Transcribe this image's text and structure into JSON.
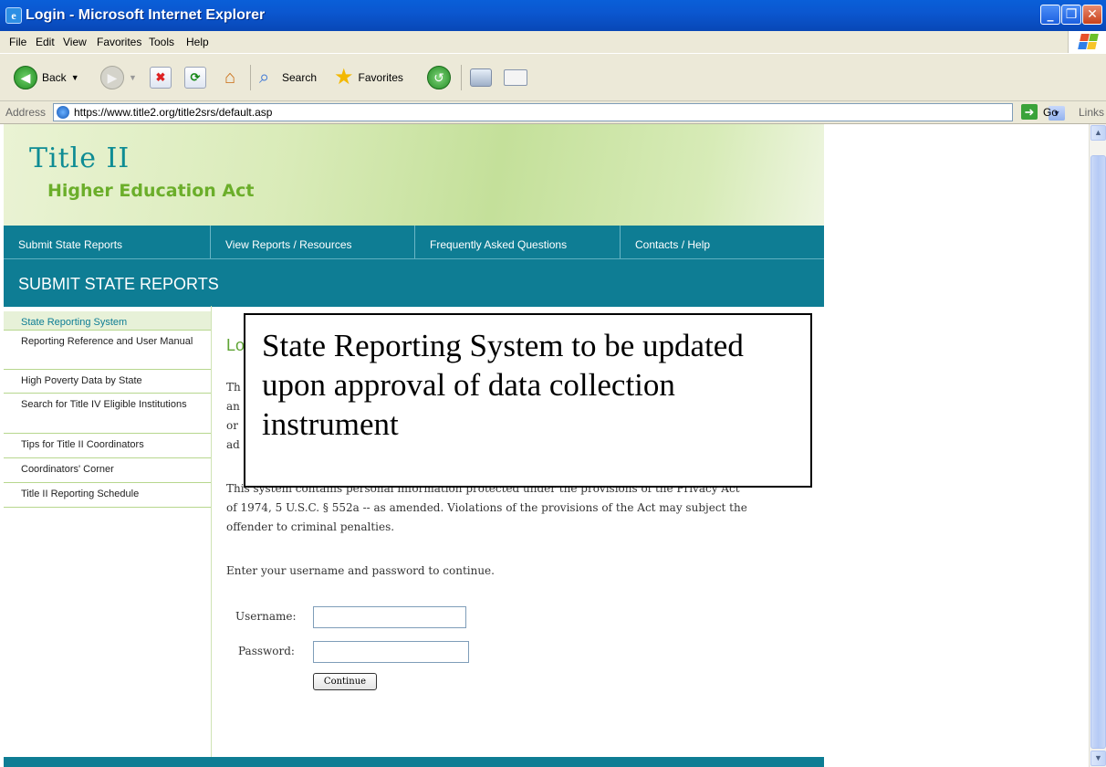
{
  "window": {
    "title": "Login - Microsoft Internet Explorer",
    "minimize": "_",
    "maximize": "❐",
    "close": "✕"
  },
  "menu": [
    "File",
    "Edit",
    "View",
    "Favorites",
    "Tools",
    "Help"
  ],
  "toolbar": {
    "back": "Back",
    "search": "Search",
    "favorites": "Favorites"
  },
  "address": {
    "label": "Address",
    "url": "https://www.title2.org/title2srs/default.asp",
    "go": "Go",
    "links": "Links"
  },
  "site": {
    "logo_title": "Title II",
    "logo_subtitle": "Higher Education Act",
    "nav": [
      "Submit State Reports",
      "View Reports / Resources",
      "Frequently Asked Questions",
      "Contacts / Help"
    ],
    "section_title": "SUBMIT STATE REPORTS",
    "sidebar": [
      "State Reporting System",
      "Reporting Reference and User Manual",
      "High Poverty Data by State",
      "Search for Title IV Eligible Institutions",
      "Tips for Title II Coordinators",
      "Coordinators' Corner",
      "Title II Reporting Schedule"
    ],
    "heading_fragment": "Lo",
    "fragments": [
      "Th",
      "an",
      "or",
      "ad"
    ],
    "privacy_line1": "This system contains personal information protected under the provisions of the Privacy Act",
    "privacy_line2": "of 1974, 5 U.S.C. § 552a -- as amended. Violations of the provisions of the Act may subject the",
    "privacy_line3": "offender to criminal penalties.",
    "enter_prompt": "Enter your username and password to continue.",
    "username_label": "Username:",
    "username_value": "",
    "password_label": "Password:",
    "password_value": "",
    "continue_label": "Continue"
  },
  "overlay_notice": "State Reporting System to be updated upon approval of data collection instrument"
}
